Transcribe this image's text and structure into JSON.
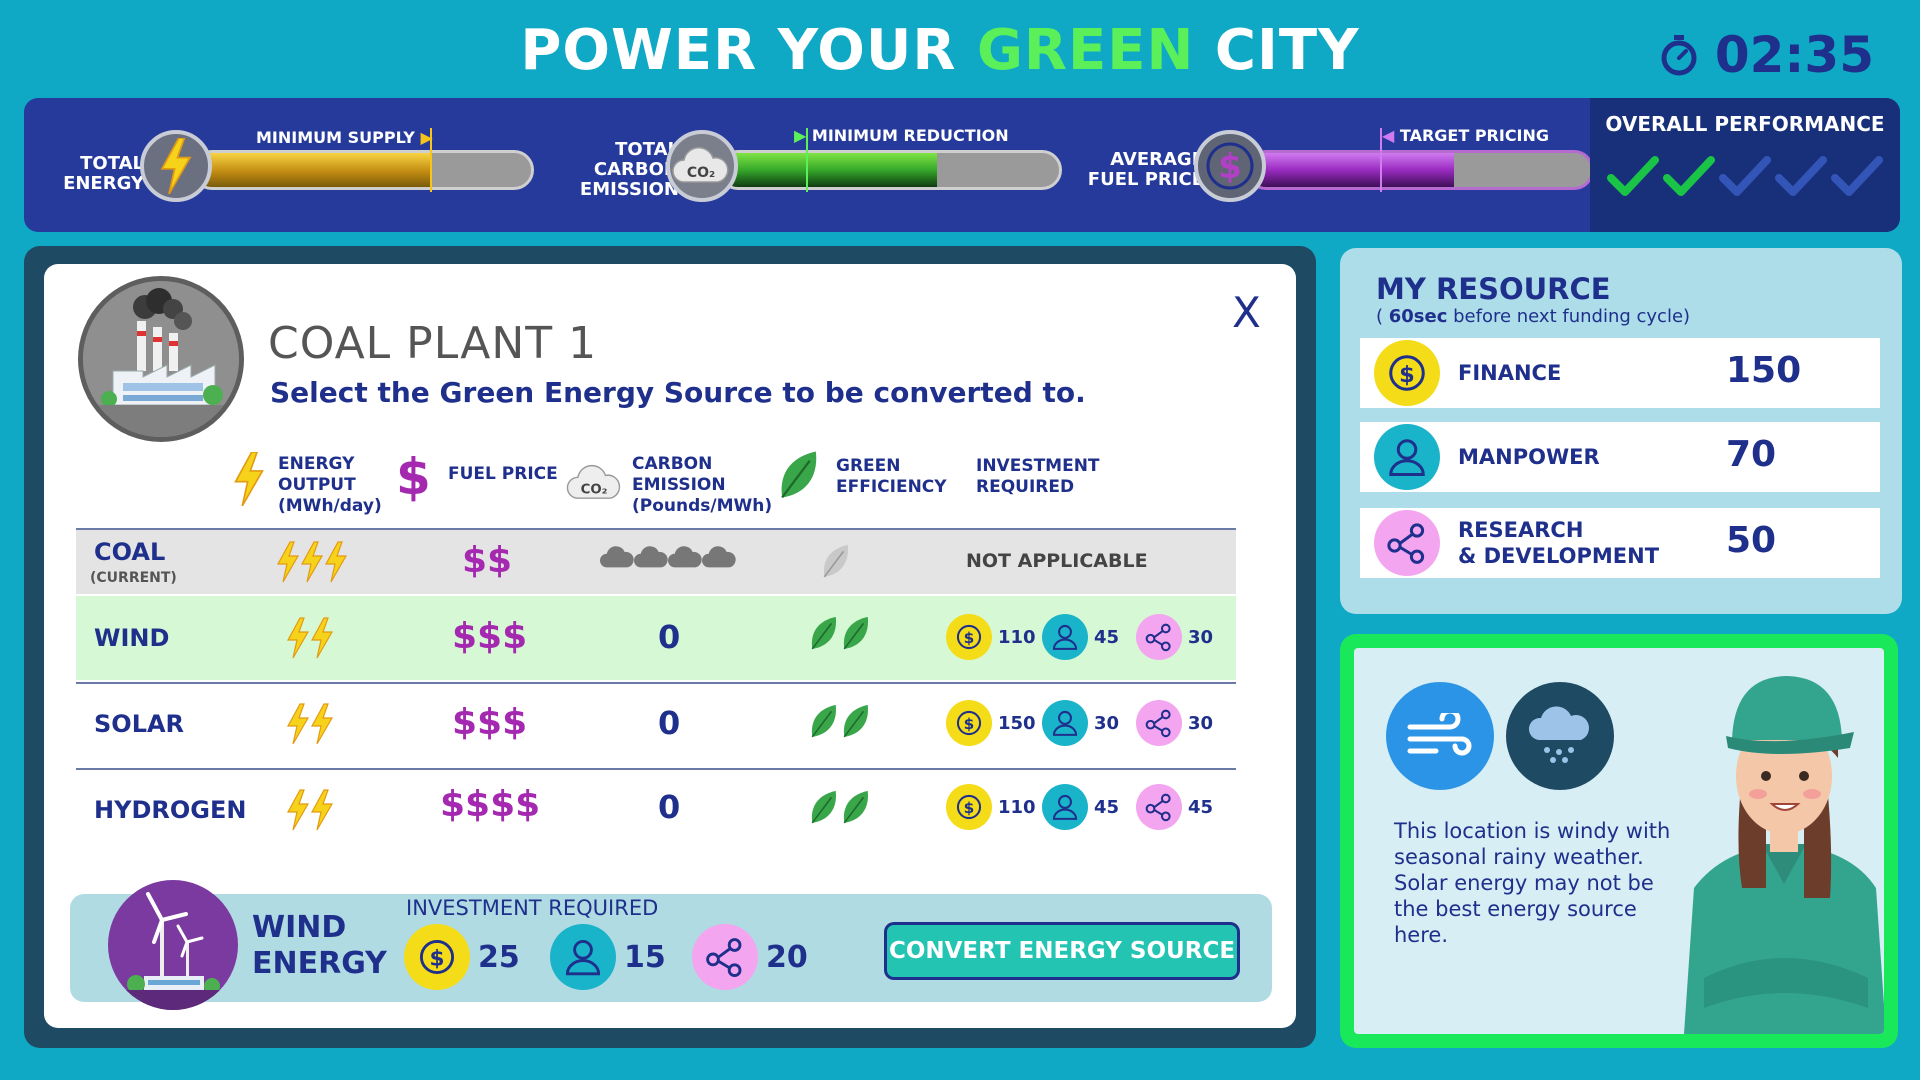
{
  "header": {
    "title_part1": "POWER YOUR ",
    "title_part2": "GREEN",
    "title_part3": " CITY",
    "timer": "02:35"
  },
  "stats": {
    "energy": {
      "label_line1": "TOTAL",
      "label_line2": "ENERGY",
      "marker": "MINIMUM SUPPLY",
      "fill_fraction": 0.7
    },
    "carbon": {
      "label_line1": "TOTAL",
      "label_line2": "CARBON",
      "label_line3": "EMISSION",
      "icon_text": "CO₂",
      "marker": "MINIMUM REDUCTION",
      "fill_fraction": 0.64
    },
    "price": {
      "label_line1": "AVERAGE",
      "label_line2": "FUEL PRICE",
      "marker": "TARGET PRICING",
      "fill_fraction": 0.6
    },
    "performance": {
      "title": "OVERALL PERFORMANCE",
      "checks_total": 5,
      "checks_achieved": 2,
      "achieved_color": "#19c447",
      "pending_color": "#3455b8"
    }
  },
  "plant": {
    "name": "COAL PLANT 1",
    "instruction": "Select the Green Energy Source to be converted to.",
    "close_label": "X"
  },
  "columns": {
    "energy_l1": "ENERGY",
    "energy_l2": "OUTPUT",
    "energy_l3": "(MWh/day)",
    "price": "FUEL PRICE",
    "carbon_icon": "CO₂",
    "carbon_l1": "CARBON",
    "carbon_l2": "EMISSION",
    "carbon_l3": "(Pounds/MWh)",
    "green_l1": "GREEN",
    "green_l2": "EFFICIENCY",
    "invest_l1": "INVESTMENT",
    "invest_l2": "REQUIRED"
  },
  "rows": [
    {
      "name": "COAL",
      "sub": "(CURRENT)",
      "energy_level": 3,
      "price": "$$",
      "carbon_level": 4,
      "green_level": 1,
      "investment": "NOT APPLICABLE"
    },
    {
      "name": "WIND",
      "energy_level": 2,
      "price": "$$$",
      "carbon": "0",
      "green_level": 2,
      "finance": "110",
      "manpower": "45",
      "rnd": "30"
    },
    {
      "name": "SOLAR",
      "energy_level": 2,
      "price": "$$$",
      "carbon": "0",
      "green_level": 2,
      "finance": "150",
      "manpower": "30",
      "rnd": "30"
    },
    {
      "name": "HYDROGEN",
      "energy_level": 2,
      "price": "$$$$",
      "carbon": "0",
      "green_level": 2,
      "finance": "110",
      "manpower": "45",
      "rnd": "45"
    }
  ],
  "selection": {
    "name_line1": "WIND",
    "name_line2": "ENERGY",
    "investment_label": "INVESTMENT REQUIRED",
    "finance": "25",
    "manpower": "15",
    "rnd": "20",
    "button": "CONVERT ENERGY SOURCE"
  },
  "resources": {
    "title": "MY RESOURCE",
    "sub_open": "( ",
    "sub_bold": "60sec",
    "sub_rest": " before next funding cycle)",
    "finance": {
      "label": "FINANCE",
      "value": "150"
    },
    "manpower": {
      "label": "MANPOWER",
      "value": "70"
    },
    "rnd": {
      "label_line1": "RESEARCH",
      "label_line2": "& DEVELOPMENT",
      "value": "50"
    }
  },
  "tip": {
    "text": "This location is windy with seasonal rainy weather. Solar energy may not be the best energy source here."
  },
  "colors": {
    "background": "#0fa9c6",
    "navy": "#1f2f8c",
    "coin_yellow": "#f4dc18",
    "manpower_teal": "#19b4c9",
    "rnd_pink": "#f3a5f0",
    "price_purple": "#a429b0",
    "wind_row": "#d7f8d5",
    "convert_button": "#24c4b3"
  },
  "icons": [
    "timer-icon",
    "lightning-icon",
    "co2-cloud-icon",
    "dollar-icon",
    "checkmark-icon",
    "factory-icon",
    "leaf-icon",
    "cloud-icon",
    "coin-icon",
    "person-icon",
    "molecule-icon",
    "wind-turbine-icon",
    "wind-icon",
    "rain-cloud-icon",
    "worker-character"
  ]
}
